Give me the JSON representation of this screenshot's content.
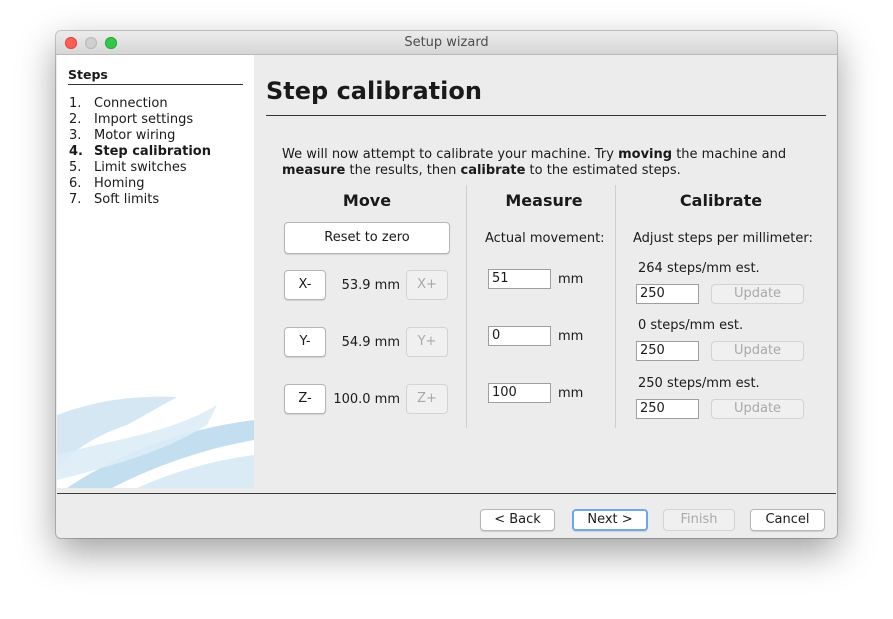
{
  "window": {
    "title": "Setup wizard"
  },
  "sidebar": {
    "heading": "Steps",
    "steps": [
      {
        "num": "1.",
        "label": "Connection"
      },
      {
        "num": "2.",
        "label": "Import settings"
      },
      {
        "num": "3.",
        "label": "Motor wiring"
      },
      {
        "num": "4.",
        "label": "Step calibration"
      },
      {
        "num": "5.",
        "label": "Limit switches"
      },
      {
        "num": "6.",
        "label": "Homing"
      },
      {
        "num": "7.",
        "label": "Soft limits"
      }
    ],
    "active_step": "Step calibration"
  },
  "page": {
    "title": "Step calibration",
    "intro_parts": [
      "We will now attempt to calibrate your machine. Try ",
      "moving",
      " the machine and ",
      "measure",
      " the results, then ",
      "calibrate",
      " to the estimated steps."
    ]
  },
  "move": {
    "heading": "Move",
    "reset_label": "Reset to zero",
    "axes": [
      {
        "minus_label": "X-",
        "value": "53.9 mm",
        "plus_label": "X+"
      },
      {
        "minus_label": "Y-",
        "value": "54.9 mm",
        "plus_label": "Y+"
      },
      {
        "minus_label": "Z-",
        "value": "100.0 mm",
        "plus_label": "Z+"
      }
    ]
  },
  "measure": {
    "heading": "Measure",
    "label": "Actual movement:",
    "unit": "mm",
    "values": [
      "51",
      "0",
      "100"
    ]
  },
  "calibrate": {
    "heading": "Calibrate",
    "label": "Adjust steps per millimeter:",
    "update_label": "Update",
    "rows": [
      {
        "estimate": "264 steps/mm est.",
        "value": "250"
      },
      {
        "estimate": "0 steps/mm est.",
        "value": "250"
      },
      {
        "estimate": "250 steps/mm est.",
        "value": "250"
      }
    ]
  },
  "footer": {
    "back": "< Back",
    "next": "Next >",
    "finish": "Finish",
    "cancel": "Cancel"
  },
  "colors": {
    "close": "#fc5f57",
    "minimize": "#cfcfcf",
    "maximize": "#34c84a",
    "default_button_ring": "#6ea8e6"
  }
}
